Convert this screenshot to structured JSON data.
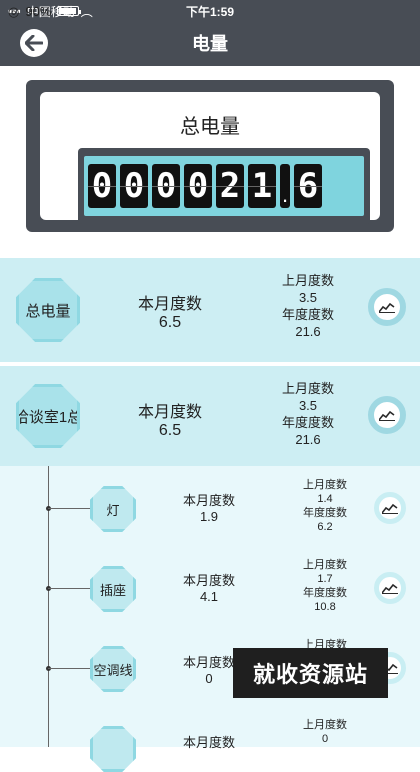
{
  "status": {
    "carrier": "中国移动",
    "time": "下午1:59",
    "battery": "90%"
  },
  "nav": {
    "title": "电量"
  },
  "hero": {
    "label": "总电量",
    "digits": [
      "0",
      "0",
      "0",
      "0",
      "2",
      "1"
    ],
    "decimal": "6"
  },
  "total": {
    "name": "总电量",
    "month_label": "本月度数",
    "month_value": "6.5",
    "last_label": "上月度数",
    "last_value": "3.5",
    "year_label": "年度度数",
    "year_value": "21.6"
  },
  "room": {
    "name": "洽谈室1总",
    "month_label": "本月度数",
    "month_value": "6.5",
    "last_label": "上月度数",
    "last_value": "3.5",
    "year_label": "年度度数",
    "year_value": "21.6"
  },
  "children": [
    {
      "name": "灯",
      "month_label": "本月度数",
      "month_value": "1.9",
      "last_label": "上月度数",
      "last_value": "1.4",
      "year_label": "年度度数",
      "year_value": "6.2"
    },
    {
      "name": "插座",
      "month_label": "本月度数",
      "month_value": "4.1",
      "last_label": "上月度数",
      "last_value": "1.7",
      "year_label": "年度度数",
      "year_value": "10.8"
    },
    {
      "name": "空调线",
      "month_label": "本月度数",
      "month_value": "0",
      "last_label": "上月度数",
      "last_value": "",
      "year_label": "",
      "year_value": ""
    },
    {
      "name": "",
      "month_label": "本月度数",
      "month_value": "",
      "last_label": "上月度数",
      "last_value": "0",
      "year_label": "",
      "year_value": ""
    }
  ],
  "watermark": "就收资源站"
}
